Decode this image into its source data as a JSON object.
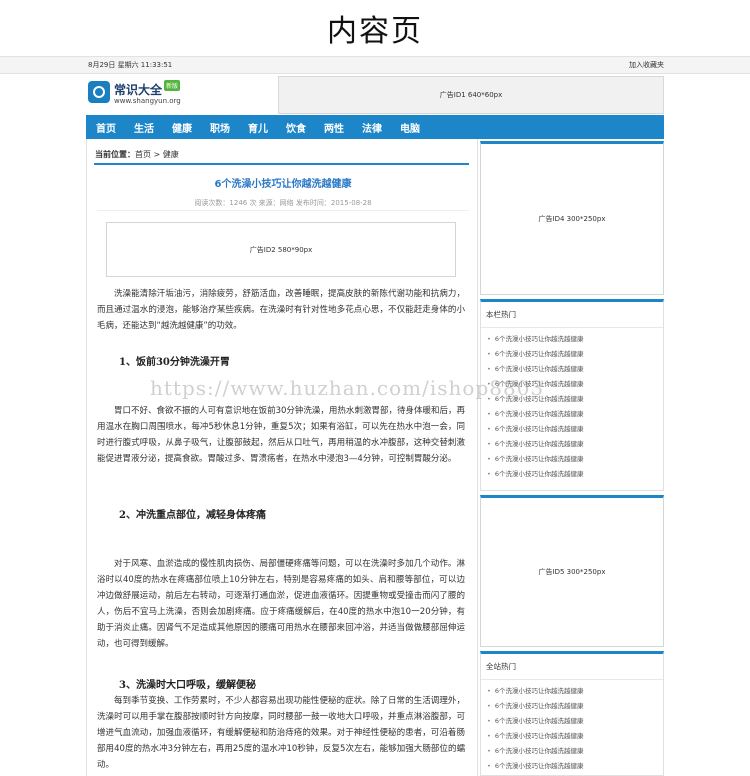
{
  "banner": {
    "title": "内容页"
  },
  "topbar": {
    "datetime": "8月29日 星期六 11:33:51",
    "bookmark": "加入收藏夹"
  },
  "logo": {
    "name": "常识大全",
    "badge": "新版",
    "url": "www.shangyun.org"
  },
  "header_ad": "广告ID1 640*60px",
  "nav": [
    "首页",
    "生活",
    "健康",
    "职场",
    "育儿",
    "饮食",
    "两性",
    "法律",
    "电脑"
  ],
  "breadcrumb": {
    "label": "当前位置：",
    "home": "首页",
    "sep": ">",
    "current": "健康"
  },
  "article": {
    "title": "6个洗澡小技巧让你越洗越健康",
    "meta": "阅读次数：1246 次  来源：网络  发布时间：2015-08-28",
    "inline_ad": "广告ID2 580*90px",
    "intro": "洗澡能清除汗垢油污，消除疲劳，舒筋活血，改善睡眠，提高皮肤的新陈代谢功能和抗病力，而且通过温水的浸泡，能够治疗某些疾病。在洗澡时有针对性地多花点心思，不仅能赶走身体的小毛病，还能达到“越洗越健康”的功效。",
    "h1": "1、饭前30分钟洗澡开胃",
    "p1": "胃口不好、食欲不振的人可有意识地在饭前30分钟洗澡，用热水刺激胃部，待身体暖和后，再用温水在胸口周围喷水，每冲5秒休息1分钟，重复5次；如果有浴缸，可以先在热水中泡一会，同时进行腹式呼吸，从鼻子吸气，让腹部鼓起，然后从口吐气，再用稍温的水冲腹部，这种交替刺激能促进胃液分泌，提高食欲。胃酸过多、胃溃疡者，在热水中浸泡3—4分钟，可控制胃酸分泌。",
    "h2": "2、冲洗重点部位，减轻身体疼痛",
    "p2": "对于风寒、血淤造成的慢性肌肉损伤、局部僵硬疼痛等问题，可以在洗澡时多加几个动作。淋浴时以40度的热水在疼痛部位喷上10分钟左右，特别是容易疼痛的如头、肩和腰等部位，可以边冲边做舒展运动，前后左右转动，可逐渐打通血淤，促进血液循环。因提重物或受撞击而闪了腰的人，伤后不宜马上洗澡，否则会加剧疼痛。应于疼痛缓解后，在40度的热水中泡10一20分钟，有助于消炎止痛。因肾气不足造成其他原因的腰痛可用热水在腰部来回冲浴，并适当做做腰部屈伸运动，也可得到缓解。",
    "h3": "3、洗澡时大口呼吸，缓解便秘",
    "p3": "每到季节变换、工作劳累时，不少人都容易出现功能性便秘的症状。除了日常的生活调理外，洗澡时可以用手掌在腹部按顺时针方向按摩，同时腰部一鼓一收地大口呼吸，并重点淋浴腹部，可增进气血流动，加强血液循环，有缓解便秘和防治痔疮的效果。对于神经性便秘的患者，可沿着肠部用40度的热水冲3分钟左右，再用25度的温水冲10秒钟，反复5次左右，能够加强大肠部位的蠕动。"
  },
  "sidebar": {
    "ad4": "广告ID4 300*250px",
    "col_hot": {
      "title": "本栏热门",
      "items": [
        "6个洗澡小技巧让你越洗越健康",
        "6个洗澡小技巧让你越洗越健康",
        "6个洗澡小技巧让你越洗越健康",
        "6个洗澡小技巧让你越洗越健康",
        "6个洗澡小技巧让你越洗越健康",
        "6个洗澡小技巧让你越洗越健康",
        "6个洗澡小技巧让你越洗越健康",
        "6个洗澡小技巧让你越洗越健康",
        "6个洗澡小技巧让你越洗越健康",
        "6个洗澡小技巧让你越洗越健康"
      ]
    },
    "ad5": "广告ID5 300*250px",
    "site_hot": {
      "title": "全站热门",
      "items": [
        "6个洗澡小技巧让你越洗越健康",
        "6个洗澡小技巧让你越洗越健康",
        "6个洗澡小技巧让你越洗越健康",
        "6个洗澡小技巧让你越洗越健康",
        "6个洗澡小技巧让你越洗越健康",
        "6个洗澡小技巧让你越洗越健康"
      ]
    }
  },
  "watermark": "https://www.huzhan.com/ishop8803",
  "colors": {
    "accent": "#1c86c9",
    "title": "#2a78c4",
    "badge": "#52b43c"
  }
}
